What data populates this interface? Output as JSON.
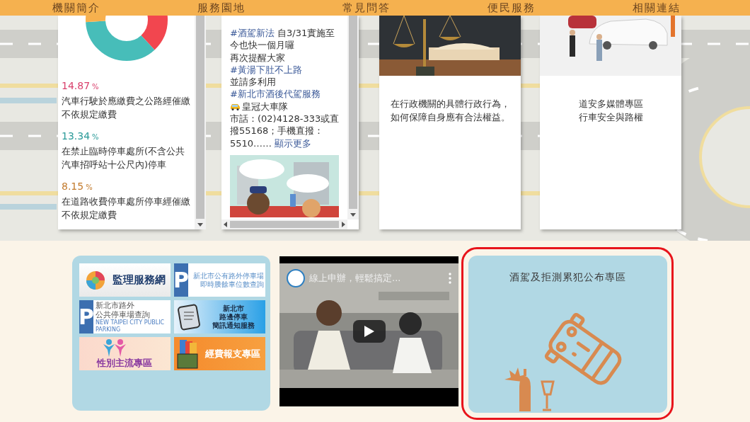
{
  "nav": [
    {
      "label": "機關簡介"
    },
    {
      "label": "服務園地"
    },
    {
      "label": "常見問答"
    },
    {
      "label": "便民服務"
    },
    {
      "label": "相關連結"
    }
  ],
  "violation_stats": {
    "items": [
      {
        "value": "14.87",
        "unit": "%",
        "color": "#d9406c",
        "description": "汽車行駛於應繳費之公路經催繳不依規定繳費"
      },
      {
        "value": "13.34",
        "unit": "%",
        "color": "#2a9a98",
        "description": "在禁止臨時停車處所(不含公共汽車招呼站十公尺內)停車"
      },
      {
        "value": "8.15",
        "unit": "%",
        "color": "#c27a2c",
        "description": "在道路收費停車處所停車經催繳不依規定繳費"
      }
    ]
  },
  "facebook_post": {
    "paragraphs": [
      {
        "kind": "text",
        "parts": [
          {
            "kind": "link",
            "text": "#酒駕新法"
          },
          {
            "kind": "text",
            "text": " 自3/31實施至今也快一個月囉"
          }
        ]
      },
      {
        "kind": "text",
        "parts": [
          {
            "kind": "text",
            "text": "再次提醒大家 "
          },
          {
            "kind": "link",
            "text": "#黃湯下肚不上路"
          }
        ]
      },
      {
        "kind": "text",
        "parts": [
          {
            "kind": "text",
            "text": "並請多利用 "
          },
          {
            "kind": "link",
            "text": "#新北市酒後代駕服務"
          }
        ]
      },
      {
        "kind": "taxi",
        "parts": [
          {
            "kind": "text",
            "text": "皇冠大車隊"
          }
        ]
      },
      {
        "kind": "text",
        "parts": [
          {
            "kind": "text",
            "text": "市話：(02)4128-333或直撥55168；手機直撥：5510…… "
          },
          {
            "kind": "link",
            "text": "顯示更多"
          }
        ]
      }
    ],
    "image": {
      "kind": "picture"
    }
  },
  "article_cards": [
    {
      "image": {
        "kind": "picture"
      },
      "lines": [
        "在行政機關的具體行政行為，",
        "如何保障自身應有合法權益。"
      ]
    },
    {
      "image": {
        "kind": "picture"
      },
      "lines": [
        "道安多媒體專區",
        "行車安全與路權"
      ]
    }
  ],
  "quick_links": [
    {
      "kind": "logo",
      "lines": [
        "監理服務網"
      ]
    },
    {
      "kind": "parking",
      "sign": "P",
      "lines": [
        "新北市公有路外停車場",
        "即時賸餘車位數查詢"
      ]
    },
    {
      "kind": "parking",
      "sign": "P",
      "lines": [
        "新北市路外",
        "公共停車場查詢",
        "NEW TAIPEI CITY PUBLIC PARKING"
      ]
    },
    {
      "kind": "sms",
      "lines": [
        "新北市",
        "路邊停車",
        "簡訊通知服務"
      ]
    },
    {
      "kind": "gender",
      "lines": [
        "性別主流專區"
      ]
    },
    {
      "kind": "expense",
      "lines": [
        "經費報支專區"
      ]
    }
  ],
  "video": {
    "title": "線上申辦，輕鬆搞定..."
  },
  "featured_panel": {
    "title": "酒駕及拒測累犯公布專區"
  }
}
